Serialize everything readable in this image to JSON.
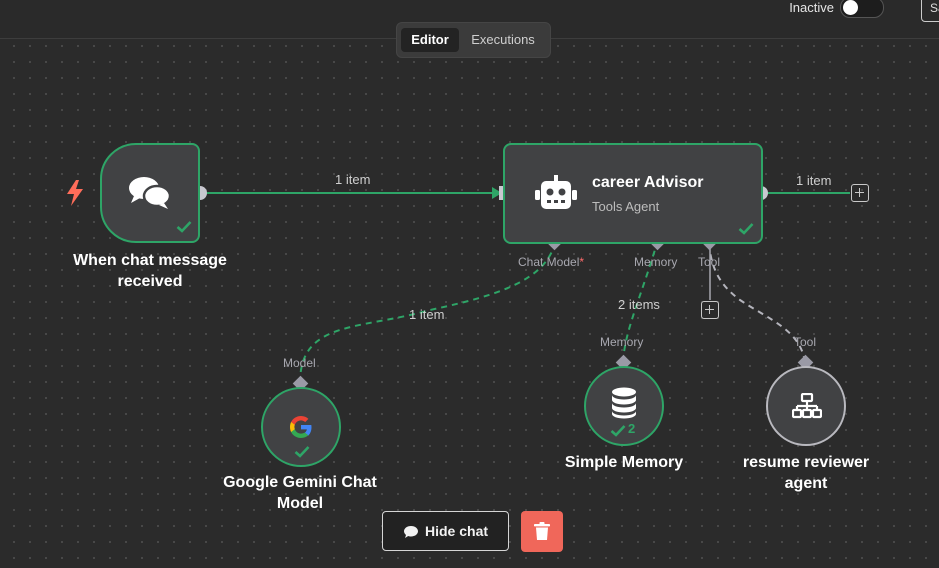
{
  "header": {
    "status_label": "Inactive",
    "active": false,
    "save_label": "Save"
  },
  "tabs": [
    {
      "label": "Editor",
      "active": true
    },
    {
      "label": "Executions",
      "active": false
    }
  ],
  "nodes": {
    "trigger": {
      "title_line1": "When chat message",
      "title_line2": "received",
      "icon": "chat-bubbles-icon",
      "status": "success"
    },
    "agent": {
      "title": "career Advisor",
      "subtitle": "Tools Agent",
      "icon": "robot-icon",
      "status": "success"
    },
    "gemini": {
      "title_line1": "Google Gemini Chat",
      "title_line2": "Model",
      "icon": "google-g-icon",
      "status": "success"
    },
    "memory": {
      "title": "Simple Memory",
      "icon": "database-icon",
      "status": "success",
      "run_count": "2"
    },
    "tool": {
      "title_line1": "resume reviewer",
      "title_line2": "agent",
      "icon": "sitemap-icon"
    }
  },
  "ports": {
    "agent_chat_model": "Chat Model",
    "agent_chat_model_required": "*",
    "agent_memory": "Memory",
    "agent_tool": "Tool",
    "gemini_model": "Model",
    "memory_memory": "Memory",
    "tool_tool": "Tool"
  },
  "edges": {
    "trigger_to_agent": "1 item",
    "agent_output": "1 item",
    "gemini_to_agent": "1 item",
    "memory_to_agent": "2 items"
  },
  "footer": {
    "hide_chat_label": "Hide chat"
  },
  "colors": {
    "success": "#2ea567",
    "canvas": "#2b2b2b",
    "node_bg": "#414244",
    "trigger_accent": "#ff6d5a",
    "delete": "#f0675a"
  }
}
